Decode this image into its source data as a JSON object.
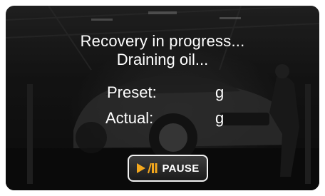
{
  "status": {
    "title": "Recovery in progress...",
    "subtitle": "Draining oil..."
  },
  "readings": [
    {
      "label": "Preset:",
      "unit": "g"
    },
    {
      "label": "Actual:",
      "unit": "g"
    }
  ],
  "controls": {
    "pause_label": "PAUSE",
    "pause_icon": "play-pause-icon"
  },
  "colors": {
    "accent": "#f4a81d",
    "text": "#ffffff",
    "background": "#1a1a1a"
  }
}
